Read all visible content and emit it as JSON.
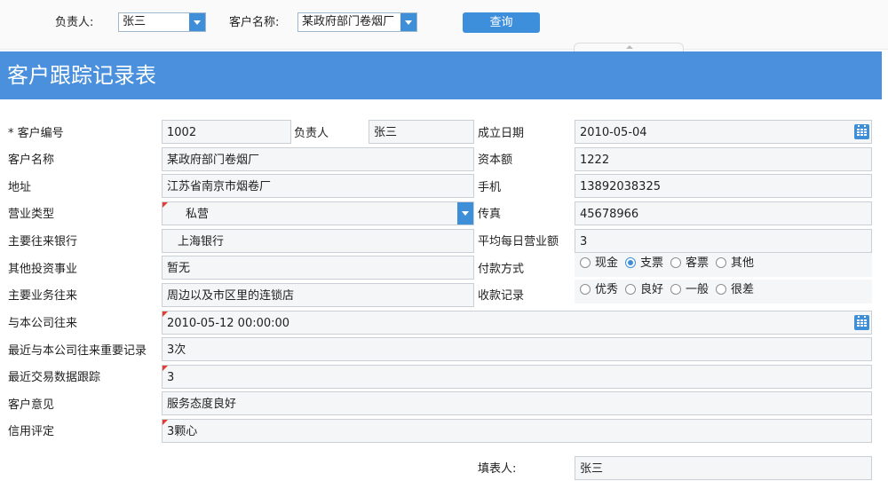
{
  "toolbar": {
    "owner_label": "负责人:",
    "owner_value": "张三",
    "customer_label": "客户名称:",
    "customer_value": "某政府部门卷烟厂",
    "query_label": "查询"
  },
  "form": {
    "title": "客户跟踪记录表",
    "fields": {
      "customer_id": {
        "label": "* 客户编号",
        "value": "1002"
      },
      "owner": {
        "label": "负责人",
        "value": "张三"
      },
      "founded": {
        "label": "成立日期",
        "value": "2010-05-04"
      },
      "customer_name": {
        "label": "客户名称",
        "value": "某政府部门卷烟厂"
      },
      "capital": {
        "label": "资本额",
        "value": "1222"
      },
      "address": {
        "label": "地址",
        "value": "江苏省南京市烟卷厂"
      },
      "mobile": {
        "label": "手机",
        "value": "13892038325"
      },
      "business_type": {
        "label": "营业类型",
        "value": "私营"
      },
      "fax": {
        "label": "传真",
        "value": "45678966"
      },
      "main_bank": {
        "label": "主要往来银行",
        "value": "上海银行"
      },
      "avg_daily_revenue": {
        "label": "平均每日营业额",
        "value": "3"
      },
      "other_investment": {
        "label": "其他投资事业",
        "value": "暂无"
      },
      "payment_method": {
        "label": "付款方式",
        "options": [
          "现金",
          "支票",
          "客票",
          "其他"
        ],
        "selected": "支票"
      },
      "main_business": {
        "label": "主要业务往来",
        "value": "周边以及市区里的连锁店"
      },
      "collection_record": {
        "label": "收款记录",
        "options": [
          "优秀",
          "良好",
          "一般",
          "很差"
        ],
        "selected": ""
      },
      "dealings": {
        "label": "与本公司往来",
        "value": "2010-05-12 00:00:00"
      },
      "important_records": {
        "label": "最近与本公司往来重要记录",
        "value": "3次"
      },
      "transaction_tracking": {
        "label": "最近交易数据跟踪",
        "value": "3"
      },
      "opinion": {
        "label": "客户意见",
        "value": "服务态度良好"
      },
      "credit_rating": {
        "label": "信用评定",
        "value": "3颗心"
      },
      "filled_by": {
        "label": "填表人:",
        "value": "张三"
      }
    }
  },
  "colors": {
    "accent": "#4a90dd",
    "field_bg": "#f4f6f8",
    "flag": "#e53c2f"
  }
}
